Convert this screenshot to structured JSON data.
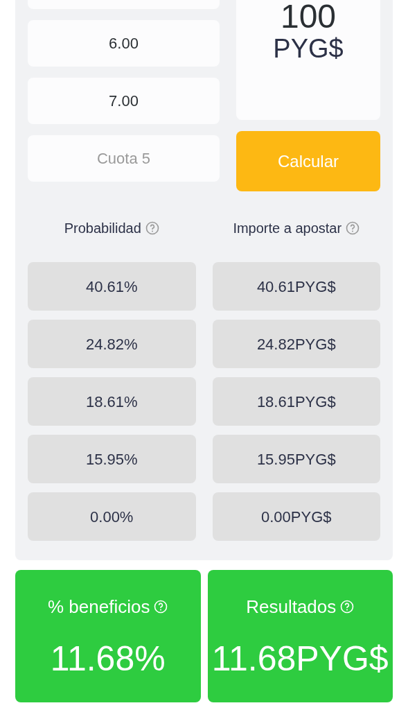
{
  "odds_fields": [
    {
      "kind": "blank"
    },
    {
      "kind": "filled",
      "value": "6.00"
    },
    {
      "kind": "filled",
      "value": "7.00"
    },
    {
      "kind": "empty",
      "placeholder": "Cuota 5"
    }
  ],
  "stake": {
    "amount": "100",
    "currency": "PYG$"
  },
  "calculate_button": "Calcular",
  "columns": [
    "Probabilidad",
    "Importe a apostar"
  ],
  "rows": [
    {
      "probability": "40.61%",
      "amount": "40.61PYG$"
    },
    {
      "probability": "24.82%",
      "amount": "24.82PYG$"
    },
    {
      "probability": "18.61%",
      "amount": "18.61PYG$"
    },
    {
      "probability": "15.95%",
      "amount": "15.95PYG$"
    },
    {
      "probability": "0.00%",
      "amount": "0.00PYG$"
    }
  ],
  "results": [
    {
      "title": "% beneficios",
      "value": "11.68%"
    },
    {
      "title": "Resultados",
      "value": "11.68PYG$"
    }
  ]
}
